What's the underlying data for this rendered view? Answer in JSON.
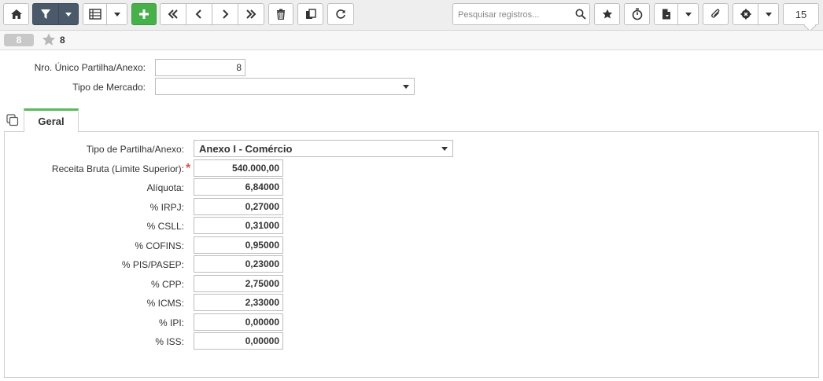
{
  "toolbar": {
    "search_placeholder": "Pesquisar registros...",
    "page_size": "15",
    "buttons": [
      "home-icon",
      "filter-icon",
      "grid-icon",
      "add-icon",
      "first-icon",
      "previous-icon",
      "next-icon",
      "last-icon",
      "delete-icon",
      "copy-icon",
      "refresh-icon",
      "favorite-icon",
      "timer-icon",
      "report-icon",
      "attach-icon",
      "settings-icon"
    ]
  },
  "record": {
    "badge": "8",
    "id": "8"
  },
  "header_form": {
    "nro_label": "Nro. Único Partilha/Anexo:",
    "nro_value": "8",
    "tipo_mercado_label": "Tipo de Mercado:",
    "tipo_mercado_value": ""
  },
  "tabs": [
    {
      "label": "Geral",
      "active": true
    }
  ],
  "geral": {
    "tipo_partilha_label": "Tipo de Partilha/Anexo:",
    "tipo_partilha_value": "Anexo I - Comércio",
    "fields": [
      {
        "label": "Receita Bruta (Limite Superior):",
        "value": "540.000,00",
        "required": true
      },
      {
        "label": "Alíquota:",
        "value": "6,84000"
      },
      {
        "label": "% IRPJ:",
        "value": "0,27000"
      },
      {
        "label": "% CSLL:",
        "value": "0,31000"
      },
      {
        "label": "% COFINS:",
        "value": "0,95000"
      },
      {
        "label": "% PIS/PASEP:",
        "value": "0,23000"
      },
      {
        "label": "% CPP:",
        "value": "2,75000"
      },
      {
        "label": "% ICMS:",
        "value": "2,33000"
      },
      {
        "label": "% IPI:",
        "value": "0,00000"
      },
      {
        "label": "% ISS:",
        "value": "0,00000"
      }
    ],
    "required_marker": "*"
  },
  "colors": {
    "add_button": "#48b04a",
    "filter_button": "#4a5a6a",
    "tab_accent": "#5cb85c",
    "required": "#d9534f"
  }
}
